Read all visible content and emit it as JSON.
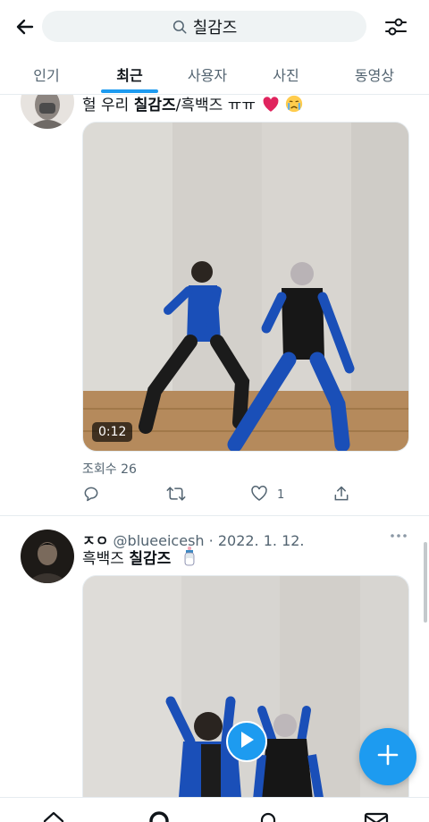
{
  "search": {
    "query": "칠감즈"
  },
  "tabs": [
    {
      "label": "인기"
    },
    {
      "label": "최근"
    },
    {
      "label": "사용자"
    },
    {
      "label": "사진"
    },
    {
      "label": "동영상"
    }
  ],
  "active_tab": "최근",
  "tweets": [
    {
      "text_before": "헐 우리 ",
      "text_bold": "칠감즈",
      "text_after": "/흑백즈 ㅠㅠ",
      "emojis": [
        "heart",
        "crying-face"
      ],
      "video_duration": "0:12",
      "views": "조회수 26",
      "like_count": "1"
    },
    {
      "name": "ㅈㅇ",
      "handle": "@blueeicesh",
      "date": "2022. 1. 12.",
      "text_before": "흑백즈 ",
      "text_bold": "칠감즈",
      "emojis": [
        "baby-bottle"
      ]
    }
  ],
  "colors": {
    "accent": "#1d9bf0",
    "text": "#0f1419",
    "muted": "#536471"
  }
}
